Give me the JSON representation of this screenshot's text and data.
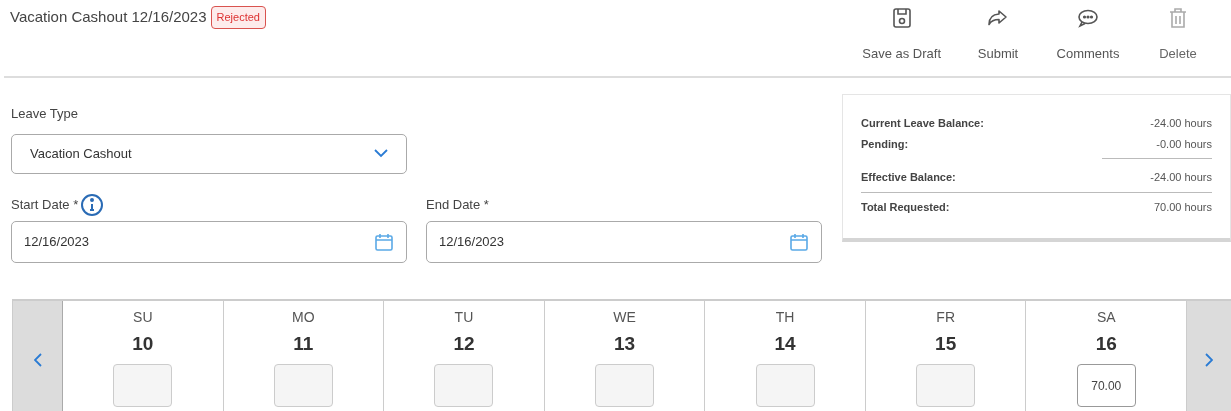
{
  "header": {
    "title": "Vacation Cashout 12/16/2023",
    "status": "Rejected"
  },
  "actions": [
    {
      "kind": "save",
      "label": "Save as Draft",
      "disabled": false
    },
    {
      "kind": "submit",
      "label": "Submit",
      "disabled": false
    },
    {
      "kind": "comments",
      "label": "Comments",
      "disabled": false
    },
    {
      "kind": "delete",
      "label": "Delete",
      "disabled": true
    }
  ],
  "leave_type": {
    "label": "Leave Type",
    "value": "Vacation Cashout"
  },
  "start_date": {
    "label": "Start Date *",
    "value": "12/16/2023"
  },
  "end_date": {
    "label": "End Date *",
    "value": "12/16/2023"
  },
  "balance": [
    {
      "label": "Current Leave Balance:",
      "value": "-24.00 hours",
      "value_underlined": false,
      "row_underlined": false
    },
    {
      "label": "Pending:",
      "value": "-0.00 hours",
      "value_underlined": true,
      "row_underlined": false
    },
    {
      "label": "Effective Balance:",
      "value": "-24.00 hours",
      "value_underlined": false,
      "row_underlined": true
    },
    {
      "label": "Total Requested:",
      "value": "70.00 hours",
      "value_underlined": false,
      "row_underlined": false
    }
  ],
  "days": [
    {
      "weekday": "SU",
      "date": "10",
      "disabled": true
    },
    {
      "weekday": "MO",
      "date": "11",
      "disabled": true
    },
    {
      "weekday": "TU",
      "date": "12",
      "disabled": true
    },
    {
      "weekday": "WE",
      "date": "13",
      "disabled": true
    },
    {
      "weekday": "TH",
      "date": "14",
      "disabled": true
    },
    {
      "weekday": "FR",
      "date": "15",
      "disabled": true
    },
    {
      "weekday": "SA",
      "date": "16",
      "disabled": false,
      "value": "70.00"
    }
  ]
}
